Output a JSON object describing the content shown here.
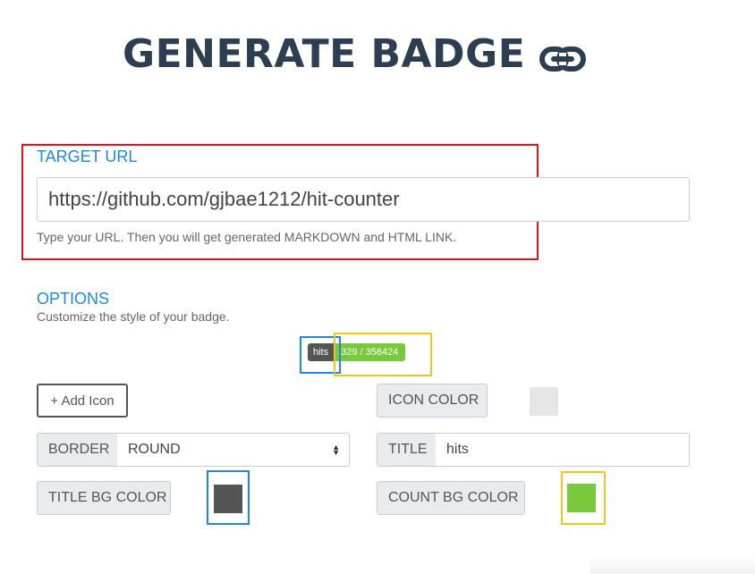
{
  "header": {
    "title": "GENERATE BADGE",
    "icon": "link-icon"
  },
  "target_url": {
    "label": "TARGET URL",
    "value": "https://github.com/gjbae1212/hit-counter",
    "help": "Type your URL. Then you will get generated MARKDOWN and HTML LINK."
  },
  "options": {
    "label": "OPTIONS",
    "help": "Customize the style of your badge.",
    "badge_preview": {
      "title": "hits",
      "count": "329 / 358424"
    },
    "add_icon_label": "+ Add Icon",
    "icon_color_label": "ICON COLOR",
    "border_label": "BORDER",
    "border_value": "ROUND",
    "title_label": "TITLE",
    "title_value": "hits",
    "title_bg_color_label": "TITLE BG COLOR",
    "count_bg_color_label": "COUNT BG COLOR"
  },
  "colors": {
    "heading": "#2c3e50",
    "accent": "#1e88e5",
    "icon_color": "#e6e6e6",
    "title_bg_color": "#555555",
    "count_bg_color": "#79c83d",
    "highlight_red": "#e8111b",
    "highlight_blue": "#1e88e5",
    "highlight_yellow": "#f5c518"
  }
}
